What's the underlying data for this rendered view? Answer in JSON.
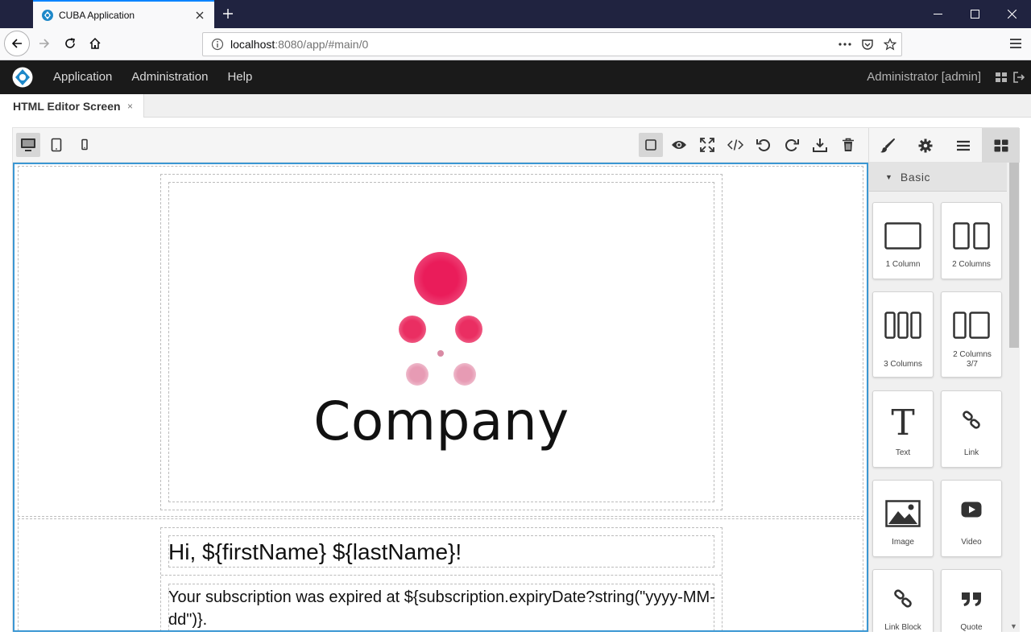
{
  "browser": {
    "tab_title": "CUBA Application",
    "url_host": "localhost",
    "url_rest": ":8080/app/#main/0"
  },
  "app": {
    "menu": [
      "Application",
      "Administration",
      "Help"
    ],
    "user": "Administrator [admin]"
  },
  "screen_tab": {
    "title": "HTML Editor Screen",
    "close": "×"
  },
  "editor": {
    "company_text": "Company",
    "greeting": "Hi, ${firstName} ${lastName}!",
    "paragraph": "Your subscription was expired at ${subscription.expiryDate?string(\"yyyy-MM-dd\")}.",
    "accent_color": "#e91e5a",
    "selection_color": "#3b97d3"
  },
  "blocks_panel": {
    "category": "Basic",
    "blocks": [
      {
        "label": "1 Column",
        "icon": "one-column-icon"
      },
      {
        "label": "2 Columns",
        "icon": "two-columns-icon"
      },
      {
        "label": "3 Columns",
        "icon": "three-columns-icon"
      },
      {
        "label": "2 Columns 3/7",
        "icon": "two-columns-37-icon"
      },
      {
        "label": "Text",
        "icon": "text-icon"
      },
      {
        "label": "Link",
        "icon": "link-icon"
      },
      {
        "label": "Image",
        "icon": "image-icon"
      },
      {
        "label": "Video",
        "icon": "video-icon"
      },
      {
        "label": "Link Block",
        "icon": "link-block-icon"
      },
      {
        "label": "Quote",
        "icon": "quote-icon"
      }
    ]
  }
}
